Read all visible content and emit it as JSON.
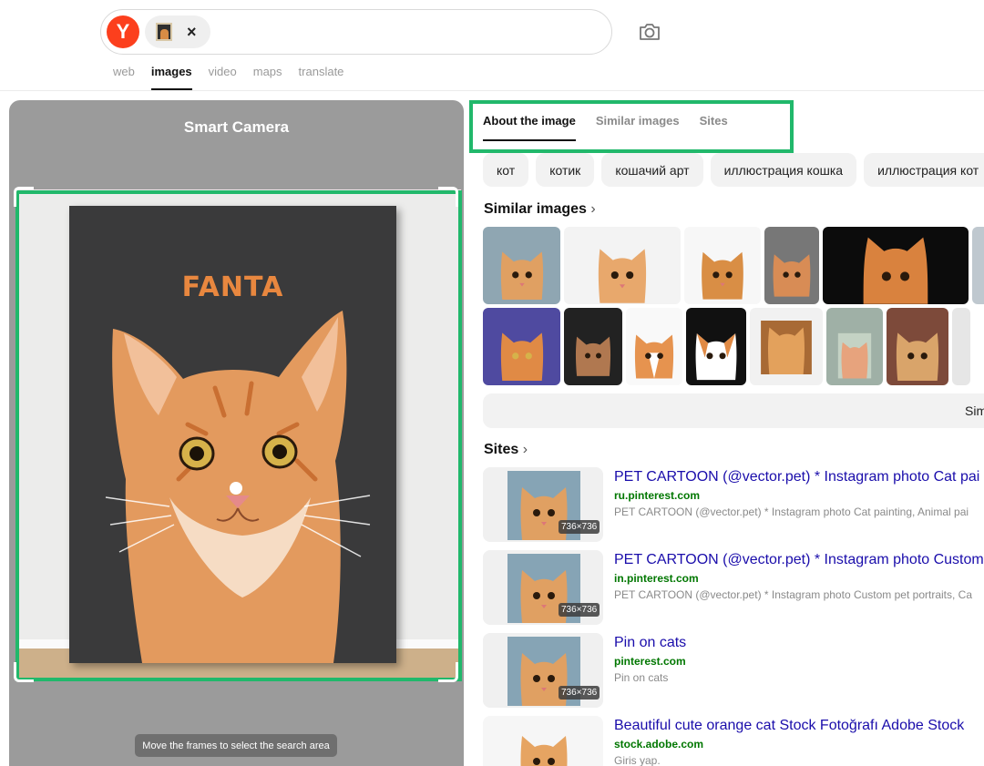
{
  "header": {
    "search_tabs": [
      {
        "label": "web",
        "active": false
      },
      {
        "label": "images",
        "active": true
      },
      {
        "label": "video",
        "active": false
      },
      {
        "label": "maps",
        "active": false
      },
      {
        "label": "translate",
        "active": false
      }
    ],
    "logo_letter": "Y",
    "chip_close": "×"
  },
  "smart_camera": {
    "title": "Smart Camera",
    "poster_text": "FANTA",
    "hint": "Move the frames to select the search area"
  },
  "results": {
    "tabs": [
      "About the image",
      "Similar images",
      "Sites"
    ],
    "tags": [
      "кот",
      "котик",
      "кошачий арт",
      "иллюстрация кошка",
      "иллюстрация кот"
    ],
    "similar_title": "Similar images",
    "similar_more_label": "Sim",
    "sites_title": "Sites",
    "sites": [
      {
        "title": "PET CARTOON (@vector.pet) * Instagram photo Cat pai",
        "domain": "ru.pinterest.com",
        "snippet": "PET CARTOON (@vector.pet) * Instagram photo Cat painting, Animal pai",
        "size": "736×736"
      },
      {
        "title": "PET CARTOON (@vector.pet) * Instagram photo Custom",
        "domain": "in.pinterest.com",
        "snippet": "PET CARTOON (@vector.pet) * Instagram photo Custom pet portraits, Ca",
        "size": "736×736"
      },
      {
        "title": "Pin on cats",
        "domain": "pinterest.com",
        "snippet": "Pin on cats",
        "size": "736×736"
      },
      {
        "title": "Beautiful cute orange cat Stock Fotoğrafı Adobe Stock",
        "domain": "stock.adobe.com",
        "snippet": "Giris yap."
      }
    ]
  },
  "colors": {
    "highlight_green": "#21b86b",
    "brand_red": "#fc3f1d",
    "link_blue": "#1a0dab",
    "domain_green": "#007700"
  }
}
